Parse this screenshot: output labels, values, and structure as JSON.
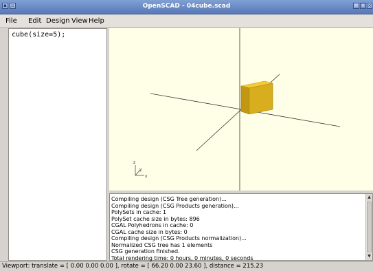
{
  "window": {
    "title": "OpenSCAD - 04cube.scad",
    "colors": {
      "titlebar": "#6b8cc7",
      "viewport_bg": "#ffffe7",
      "cube_top": "#f2cb36",
      "cube_front": "#d7aa1a",
      "cube_side": "#b38c0f"
    }
  },
  "menu": {
    "items": [
      {
        "label": "File"
      },
      {
        "label": "Edit"
      },
      {
        "label": "Design"
      },
      {
        "label": "View"
      },
      {
        "label": "Help"
      }
    ]
  },
  "editor": {
    "code": "cube(size=5);"
  },
  "viewport": {
    "axis_labels": {
      "z": "z",
      "y": "y",
      "x": "x"
    }
  },
  "console": {
    "lines": [
      "Compiling design (CSG Tree generation)...",
      "Compiling design (CSG Products generation)...",
      "PolySets in cache: 1",
      "PolySet cache size in bytes: 896",
      "CGAL Polyhedrons in cache: 0",
      "CGAL cache size in bytes: 0",
      "Compiling design (CSG Products normalization)...",
      "Normalized CSG tree has 1 elements",
      "CSG generation finished.",
      "Total rendering time: 0 hours, 0 minutes, 0 seconds"
    ]
  },
  "status": {
    "text": "Viewport: translate = [ 0.00 0.00 0.00 ], rotate = [ 66.20 0.00 23.60 ], distance = 215.23"
  }
}
